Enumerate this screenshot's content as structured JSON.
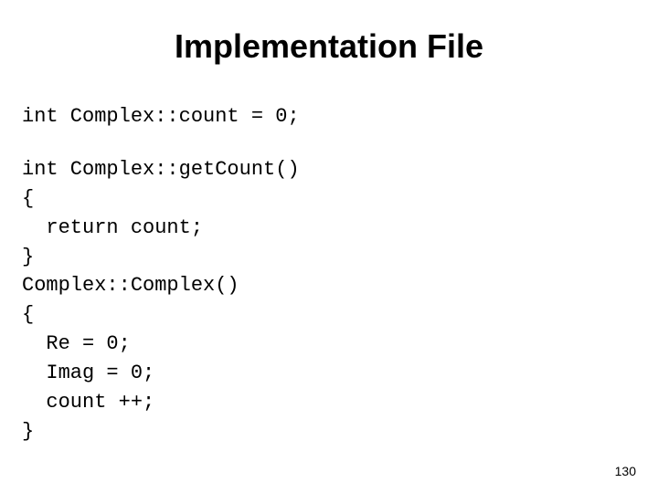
{
  "title": "Implementation File",
  "code": {
    "block1": "int Complex::count = 0;",
    "block2": "int Complex::getCount()\n{\n  return count;\n}\nComplex::Complex()\n{\n  Re = 0;\n  Imag = 0;\n  count ++;\n}"
  },
  "page_number": "130"
}
